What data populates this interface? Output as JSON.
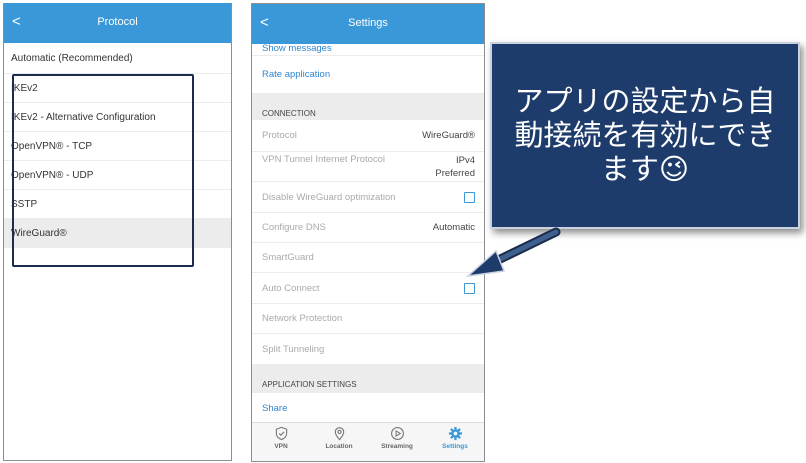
{
  "left_screen": {
    "back_glyph": "<",
    "title": "Protocol",
    "items": [
      {
        "label": "Automatic (Recommended)",
        "selected": false
      },
      {
        "label": "IKEv2",
        "selected": false
      },
      {
        "label": "IKEv2 - Alternative Configuration",
        "selected": false
      },
      {
        "label": "OpenVPN® - TCP",
        "selected": false
      },
      {
        "label": "OpenVPN® - UDP",
        "selected": false
      },
      {
        "label": "SSTP",
        "selected": false
      },
      {
        "label": "WireGuard®",
        "selected": true
      }
    ]
  },
  "right_screen": {
    "back_glyph": "<",
    "title": "Settings",
    "top_links": [
      "Show messages",
      "Rate application"
    ],
    "connection_header": "CONNECTION",
    "rows": [
      {
        "label": "Protocol",
        "value": "WireGuard®"
      },
      {
        "label": "VPN Tunnel Internet Protocol",
        "value_line1": "IPv4",
        "value_line2": "Preferred"
      },
      {
        "label": "Disable WireGuard optimization",
        "checkbox": true,
        "checked": false
      },
      {
        "label": "Configure DNS",
        "value": "Automatic"
      },
      {
        "label": "SmartGuard"
      },
      {
        "label": "Auto Connect",
        "checkbox": true,
        "checked": false
      },
      {
        "label": "Network Protection"
      },
      {
        "label": "Split Tunneling"
      }
    ],
    "app_settings_header": "APPLICATION SETTINGS",
    "share_label": "Share",
    "tabs": [
      {
        "label": "VPN",
        "icon": "shield-check-icon",
        "active": false
      },
      {
        "label": "Location",
        "icon": "location-pin-icon",
        "active": false
      },
      {
        "label": "Streaming",
        "icon": "play-circle-icon",
        "active": false
      },
      {
        "label": "Settings",
        "icon": "gear-icon",
        "active": true
      }
    ]
  },
  "callout": {
    "text": "アプリの設定から自動接続を有効にできます😉"
  },
  "colors": {
    "header_blue": "#3a98d8",
    "callout_navy": "#1e3c6b",
    "link_blue": "#2f86cf",
    "highlight_border": "#1b2d4f"
  }
}
